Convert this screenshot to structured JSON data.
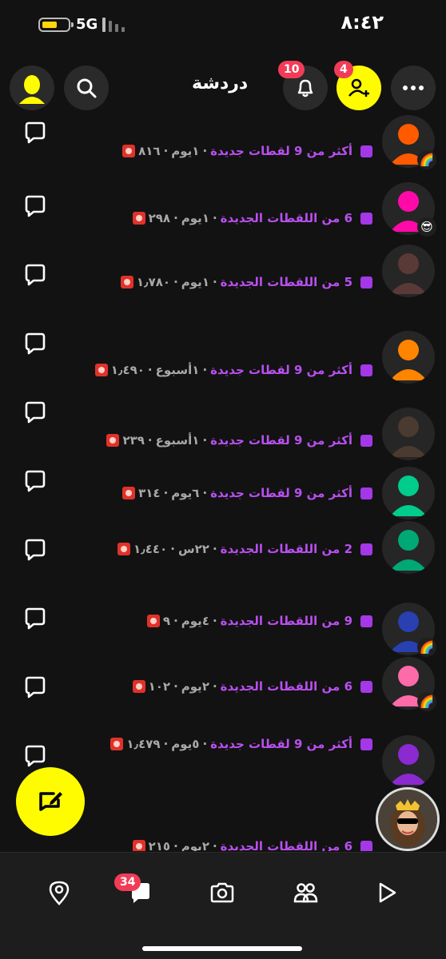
{
  "status": {
    "time": "٨:٤٢",
    "network": "5G"
  },
  "header": {
    "title": "دردشة",
    "notifications_badge": "10",
    "add_friend_badge": "4"
  },
  "chats": [
    {
      "prefix": "أكثر من",
      "count": "9",
      "suffix": "لقطات جديدة",
      "time": "١يوم",
      "streak": "٨١٦",
      "avatar_color": "#ff5a00",
      "avatar_badge": "🌈"
    },
    {
      "prefix": "",
      "count": "6",
      "suffix": "من اللقطات الجديدة",
      "time": "١يوم",
      "streak": "٢٩٨",
      "avatar_color": "#ff0aa8",
      "avatar_badge": "😎"
    },
    {
      "prefix": "",
      "count": "5",
      "suffix": "من اللقطات الجديدة",
      "time": "١يوم",
      "streak": "١٫٧٨٠",
      "avatar_color": "#5a3a36",
      "avatar_badge": ""
    },
    {
      "prefix": "أكثر من",
      "count": "9",
      "suffix": "لقطات جديدة",
      "time": "١أسبوع",
      "streak": "١٫٤٩٠",
      "avatar_color": "#ff8500",
      "avatar_badge": ""
    },
    {
      "prefix": "أكثر من",
      "count": "9",
      "suffix": "لقطات جديدة",
      "time": "١أسبوع",
      "streak": "٢٣٩",
      "avatar_color": "#4a3a30",
      "avatar_badge": ""
    },
    {
      "prefix": "أكثر من",
      "count": "9",
      "suffix": "لقطات جديدة",
      "time": "٦يوم",
      "streak": "٣١٤",
      "avatar_color": "#00cc8c",
      "avatar_badge": ""
    },
    {
      "prefix": "",
      "count": "2",
      "suffix": "من اللقطات الجديدة",
      "time": "٢٢س",
      "streak": "١٫٤٤٠",
      "avatar_color": "#00a876",
      "avatar_badge": ""
    },
    {
      "prefix": "",
      "count": "9",
      "suffix": "من اللقطات الجديدة",
      "time": "٤يوم",
      "streak": "٩",
      "avatar_color": "#2840b0",
      "avatar_badge": "🌈"
    },
    {
      "prefix": "",
      "count": "6",
      "suffix": "من اللقطات الجديدة",
      "time": "٢يوم",
      "streak": "١٠٢",
      "avatar_color": "#ff6aa8",
      "avatar_badge": "🌈"
    },
    {
      "prefix": "أكثر من",
      "count": "9",
      "suffix": "لقطات جديدة",
      "time": "٥يوم",
      "streak": "١٫٤٧٩",
      "avatar_color": "#8a2ad0",
      "avatar_badge": ""
    },
    {
      "prefix": "",
      "count": "6",
      "suffix": "من اللقطات الجديدة",
      "time": "٢يوم",
      "streak": "٢١٥",
      "avatar_color": "",
      "avatar_badge": ""
    }
  ],
  "bottom_nav": {
    "chat_badge": "34"
  }
}
